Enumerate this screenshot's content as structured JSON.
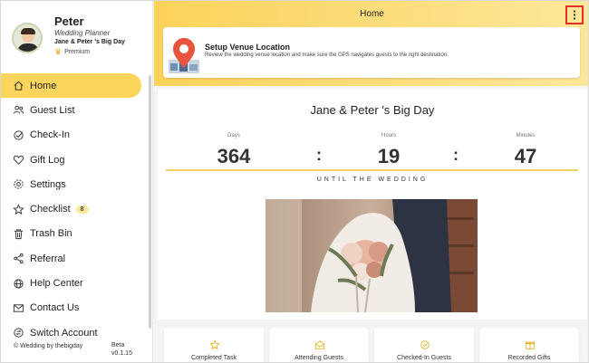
{
  "profile": {
    "name": "Peter",
    "role": "Wedding Planner",
    "event": "Jane & Peter 's Big Day",
    "tier": "Premium"
  },
  "nav": {
    "items": [
      {
        "label": "Home",
        "icon": "home-icon"
      },
      {
        "label": "Guest List",
        "icon": "guests-icon"
      },
      {
        "label": "Check-In",
        "icon": "check-in-icon"
      },
      {
        "label": "Gift Log",
        "icon": "heart-icon"
      },
      {
        "label": "Settings",
        "icon": "gear-icon"
      },
      {
        "label": "Checklist",
        "icon": "star-icon",
        "badge": "8"
      },
      {
        "label": "Trash Bin",
        "icon": "trash-icon"
      },
      {
        "label": "Referral",
        "icon": "share-icon"
      },
      {
        "label": "Help Center",
        "icon": "globe-icon"
      },
      {
        "label": "Contact Us",
        "icon": "mail-icon"
      },
      {
        "label": "Switch Account",
        "icon": "switch-account-icon"
      }
    ]
  },
  "footer": {
    "copyright": "© Wedding by thebigday",
    "version_label": "Beta",
    "version": "v0.1.15"
  },
  "header": {
    "title": "Home",
    "menu_icon": "more-vertical-icon"
  },
  "venue": {
    "title": "Setup Venue Location",
    "description": "Review the wedding venue location and make sure the GPS navigates guests to the right destination."
  },
  "countdown": {
    "title": "Jane & Peter 's Big Day",
    "days_label": "Days",
    "days": "364",
    "hours_label": "Hours",
    "hours": "19",
    "minutes_label": "Minutes",
    "minutes": "47",
    "separator": ":",
    "until_text": "UNTIL THE WEDDING"
  },
  "stats": [
    {
      "label": "Completed Task",
      "icon": "star-icon"
    },
    {
      "label": "Attending Guests",
      "icon": "mail-open-icon"
    },
    {
      "label": "Checked-In Guests",
      "icon": "check-circle-icon"
    },
    {
      "label": "Recorded Gifts",
      "icon": "gift-icon"
    }
  ],
  "colors": {
    "accent": "#fcd55c",
    "header_gradient_start": "#fcd25a",
    "header_gradient_end": "#fde79a",
    "highlight_border": "#e8302a",
    "pin_red": "#e8553f"
  }
}
